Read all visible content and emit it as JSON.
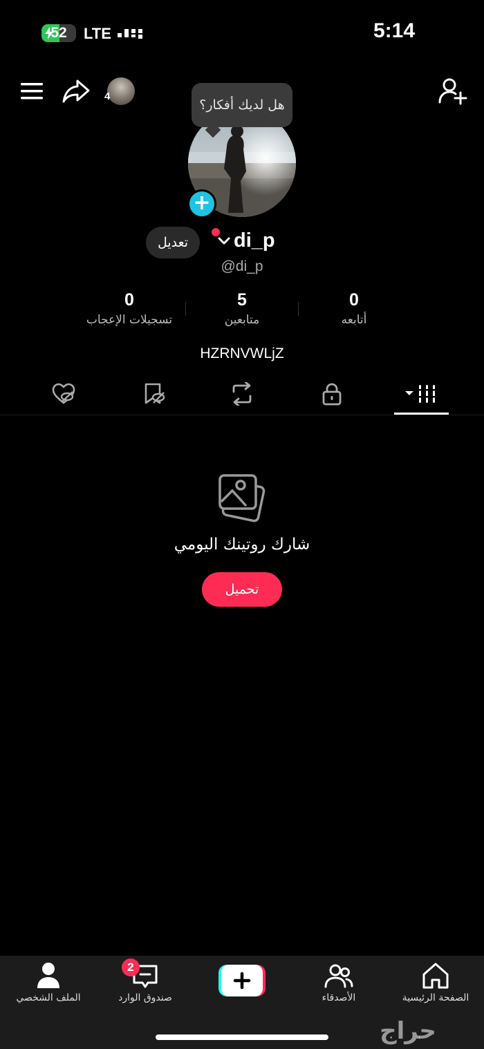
{
  "status_bar": {
    "battery_level": "52",
    "battery_percent": 52,
    "network": "LTE",
    "time": "5:14"
  },
  "header": {
    "menu_icon": "menu-icon",
    "share_icon": "share-icon",
    "account_count": "4",
    "add_friend_icon": "add-user-icon"
  },
  "thoughts_bubble": "هل لديك أفكار؟",
  "profile": {
    "edit_label": "تعديل",
    "username": "di_p",
    "handle": "@di_p",
    "bio": "HZRNVWLjZ",
    "stats": [
      {
        "value": "0",
        "label": "تسجيلات الإعجاب"
      },
      {
        "value": "5",
        "label": "متابعين"
      },
      {
        "value": "0",
        "label": "أتابعه"
      }
    ]
  },
  "tabs": [
    {
      "icon": "liked-hidden-icon"
    },
    {
      "icon": "favorites-hidden-icon"
    },
    {
      "icon": "repost-icon"
    },
    {
      "icon": "lock-icon"
    },
    {
      "icon": "videos-grid-icon",
      "active": true
    }
  ],
  "empty_state": {
    "icon": "photos-icon",
    "message": "شارك روتينك اليومي",
    "upload_label": "تحميل"
  },
  "bottom_nav": {
    "items": [
      {
        "label": "الملف الشخصي",
        "icon": "profile-icon",
        "active": true
      },
      {
        "label": "صندوق الوارد",
        "icon": "inbox-icon",
        "badge": "2"
      },
      {
        "label": "",
        "icon": "create-icon"
      },
      {
        "label": "الأصدقاء",
        "icon": "friends-icon"
      },
      {
        "label": "الصفحة الرئيسية",
        "icon": "home-icon"
      }
    ]
  },
  "watermark": "حراج",
  "colors": {
    "background": "#000000",
    "accent_red": "#fe2c55",
    "accent_cyan": "#1fc3e3",
    "battery_green": "#30c55a",
    "nav_background": "#1c1c1c"
  }
}
